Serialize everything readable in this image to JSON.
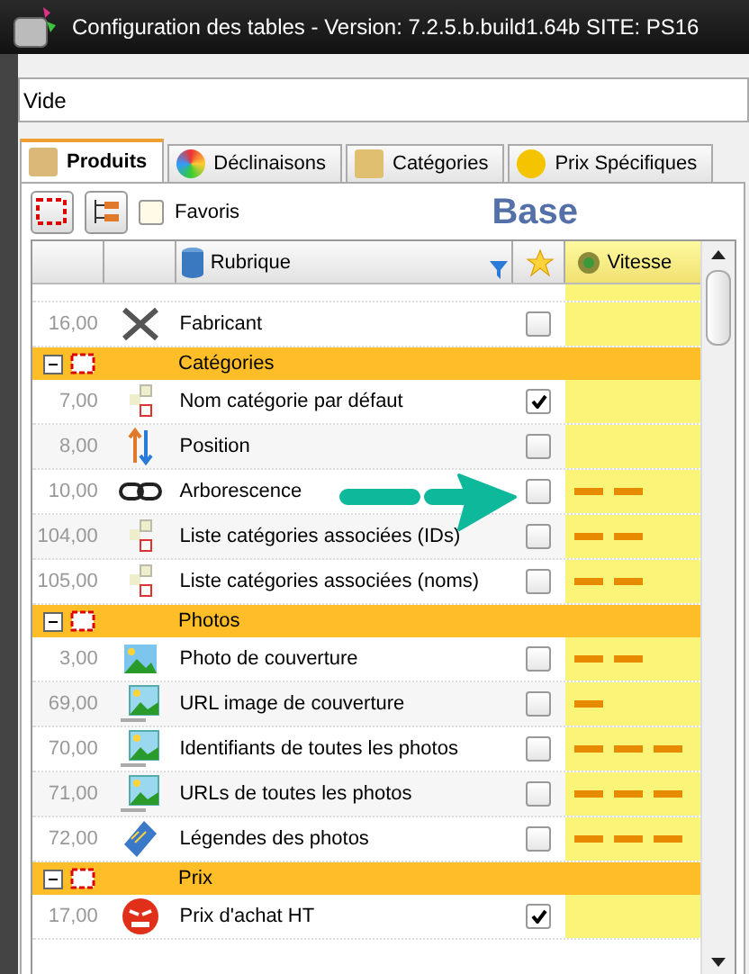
{
  "window": {
    "title": "Configuration des tables  -  Version:  7.2.5.b.build1.64b     SITE: PS16"
  },
  "filter_field": {
    "value": "Vide"
  },
  "tabs": [
    {
      "label": "Produits",
      "selected": true
    },
    {
      "label": "Déclinaisons",
      "selected": false
    },
    {
      "label": "Catégories",
      "selected": false
    },
    {
      "label": "Prix Spécifiques",
      "selected": false
    }
  ],
  "toolbar": {
    "favorites": {
      "label": "Favoris",
      "checked": false
    },
    "section_title": "Base"
  },
  "table": {
    "columns": [
      "Rubrique",
      "Vitesse"
    ],
    "rows": [
      {
        "kind": "item",
        "number": "16,00",
        "name": "Fabricant",
        "checked": false
      },
      {
        "kind": "group",
        "name": "Catégories",
        "expanded": true
      },
      {
        "kind": "item",
        "number": "7,00",
        "name": "Nom catégorie par défaut",
        "checked": true
      },
      {
        "kind": "item",
        "number": "8,00",
        "name": "Position",
        "checked": false
      },
      {
        "kind": "item",
        "number": "10,00",
        "name": "Arborescence",
        "checked": false,
        "level": 0.67
      },
      {
        "kind": "item",
        "number": "104,00",
        "name": "Liste catégories associées (IDs)",
        "checked": false,
        "level": 0.67
      },
      {
        "kind": "item",
        "number": "105,00",
        "name": "Liste catégories associées (noms)",
        "checked": false,
        "level": 0.67
      },
      {
        "kind": "group",
        "name": "Photos",
        "expanded": true
      },
      {
        "kind": "item",
        "number": "3,00",
        "name": "Photo de couverture",
        "checked": false,
        "level": 0.67
      },
      {
        "kind": "item",
        "number": "69,00",
        "name": "URL image de couverture",
        "checked": false,
        "level": 0.33
      },
      {
        "kind": "item",
        "number": "70,00",
        "name": "Identifiants de toutes les photos",
        "checked": false,
        "level": 1
      },
      {
        "kind": "item",
        "number": "71,00",
        "name": "URLs de toutes les photos",
        "checked": false,
        "level": 1
      },
      {
        "kind": "item",
        "number": "72,00",
        "name": "Légendes des photos",
        "checked": false,
        "level": 1
      },
      {
        "kind": "group",
        "name": "Prix",
        "expanded": true
      },
      {
        "kind": "item",
        "number": "17,00",
        "name": "Prix d'achat HT",
        "checked": true
      }
    ]
  }
}
